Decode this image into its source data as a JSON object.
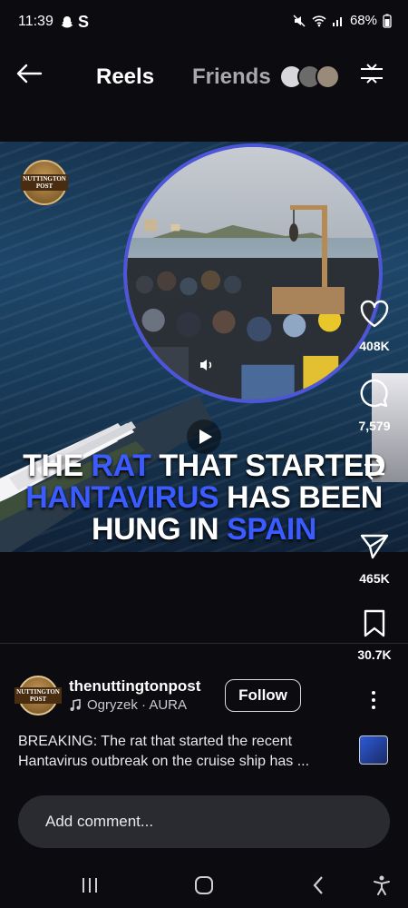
{
  "status_bar": {
    "time": "11:39",
    "battery": "68%",
    "icons": [
      "snapchat-icon",
      "s-icon",
      "mute-icon",
      "wifi-icon",
      "signal-icon",
      "battery-icon"
    ]
  },
  "top_bar": {
    "tabs": [
      {
        "label": "Reels",
        "active": true
      },
      {
        "label": "Friends",
        "active": false
      }
    ]
  },
  "video": {
    "logo_text": "NUTTINGTON POST",
    "headline": {
      "line1_blue": "RAT",
      "line1_pre": "THE ",
      "line1_post": " THAT STARTED",
      "line2_blue": "HANTAVIRUS",
      "line2_post": " HAS BEEN",
      "line3_pre": "HUNG IN ",
      "line3_blue": "SPAIN"
    }
  },
  "actions": {
    "likes": "408K",
    "comments": "7,579",
    "shares": "465K",
    "saves": "30.7K"
  },
  "post": {
    "author": "thenuttingtonpost",
    "audio": "Ogryzek · AURA",
    "follow_label": "Follow",
    "caption": "BREAKING: The rat that started the recent Hantavirus outbreak on the cruise ship has ..."
  },
  "comment": {
    "placeholder": "Add comment..."
  },
  "colors": {
    "accent_blue": "#3a5bff",
    "background": "#0b0b10"
  }
}
